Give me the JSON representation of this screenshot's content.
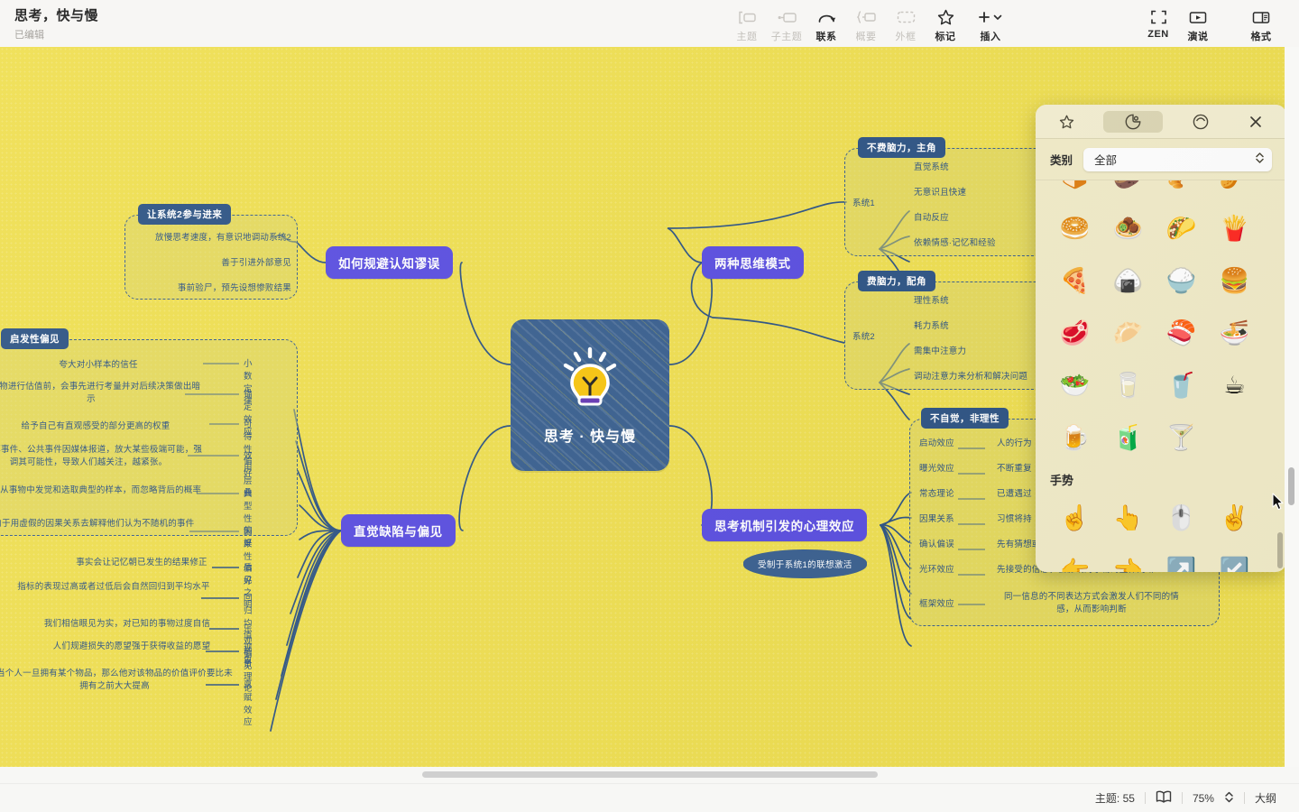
{
  "document": {
    "title": "思考，快与慢",
    "status": "已编辑"
  },
  "toolbar": {
    "center": [
      {
        "label": "主题",
        "icon": "topic-icon",
        "state": "disabled"
      },
      {
        "label": "子主题",
        "icon": "subtopic-icon",
        "state": "disabled"
      },
      {
        "label": "联系",
        "icon": "relation-icon",
        "state": "enabled"
      },
      {
        "label": "概要",
        "icon": "summary-icon",
        "state": "disabled"
      },
      {
        "label": "外框",
        "icon": "boundary-icon",
        "state": "disabled"
      },
      {
        "label": "标记",
        "icon": "marker-star-icon",
        "state": "enabled"
      },
      {
        "label": "插入",
        "icon": "plus-icon",
        "state": "enabled"
      }
    ],
    "right": [
      {
        "label": "ZEN",
        "icon": "zen-icon"
      },
      {
        "label": "演说",
        "icon": "presentation-icon"
      },
      {
        "label": "格式",
        "icon": "format-panel-icon"
      }
    ]
  },
  "sticker_panel": {
    "tabs": [
      {
        "name": "favorites",
        "icon": "star-icon",
        "selected": false
      },
      {
        "name": "stickers",
        "icon": "sticker-icon",
        "selected": true
      },
      {
        "name": "emoji",
        "icon": "emoji-icon",
        "selected": false
      }
    ],
    "close_icon": "close-icon",
    "category_label": "类别",
    "category_value": "全部",
    "category_options": [
      "全部"
    ],
    "rows": [
      {
        "type": "emoji",
        "items": [
          "🍞",
          "🥔",
          "🥐",
          "🥜"
        ]
      },
      {
        "type": "emoji",
        "items": [
          "🥯",
          "🧆",
          "🌮",
          "🍟"
        ]
      },
      {
        "type": "emoji",
        "items": [
          "🍕",
          "🍙",
          "🍚",
          "🍔"
        ]
      },
      {
        "type": "emoji",
        "items": [
          "🥩",
          "🥟",
          "🍣",
          "🍜"
        ]
      },
      {
        "type": "emoji",
        "items": [
          "🥗",
          "🥛",
          "🥤",
          "☕"
        ]
      },
      {
        "type": "emoji",
        "items": [
          "🍺",
          "🧃",
          "🍸",
          ""
        ]
      }
    ],
    "section_title": "手势",
    "gesture_rows": [
      {
        "items": [
          "☝️",
          "👆",
          "🖱️",
          "✌️"
        ]
      },
      {
        "items": [
          "👉",
          "👈",
          "↗️",
          "↙️"
        ]
      }
    ]
  },
  "mindmap": {
    "central": {
      "label": "思考 · 快与慢",
      "icon": "lightbulb-icon"
    },
    "branches": [
      {
        "id": "avoid",
        "label": "如何规避认知谬误"
      },
      {
        "id": "twomodes",
        "label": "两种思维模式"
      },
      {
        "id": "defects",
        "label": "直觉缺陷与偏见"
      },
      {
        "id": "effects",
        "label": "思考机制引发的心理效应"
      }
    ],
    "callout": "受制于系统1的联想激活",
    "groups": {
      "system2_join": {
        "tag": "让系统2参与进来",
        "items": [
          "放慢思考速度，有意识地调动系统2",
          "善于引进外部意见",
          "事前验尸，预先设想惨败结果"
        ]
      },
      "system1": {
        "tag": "不费脑力，主角",
        "root": "系统1",
        "items": [
          "直觉系统",
          "无意识且快速",
          "自动反应",
          "依赖情感·记忆和经验"
        ]
      },
      "system2": {
        "tag": "费脑力，配角",
        "root": "系统2",
        "items": [
          "理性系统",
          "耗力系统",
          "需集中注意力",
          "调动注意力来分析和解决问题"
        ]
      },
      "heuristic_bias": {
        "tag": "启发性偏见",
        "pairs": [
          {
            "desc": "夸大对小样本的信任",
            "name": "小数定律"
          },
          {
            "desc": "对事物进行估值前，会事先进行考量并对后续决策做出暗示",
            "name": "锚定效应"
          },
          {
            "desc": "给予自己有直观感受的部分更高的权重",
            "name": "可得性偏好"
          },
          {
            "desc": "小概率事件、公共事件因媒体报道，放大某些极端可能，强调其可能性，导致人们越关注，越紧张。",
            "name": "效用层叠"
          },
          {
            "desc": "习惯从事物中发觉和选取典型的样本，而忽略背后的概率",
            "name": "典型性偏好"
          },
          {
            "desc": "倾向于用虚假的因果关系去解释他们认为不随机的事件",
            "name": "因果性偏好"
          },
          {
            "desc": "事实会让记忆朝已发生的结果修正",
            "name": "后见之明"
          },
          {
            "desc": "指标的表现过高或者过低后会自然回归到平均水平",
            "name": "回归均值现象"
          },
          {
            "desc": "我们相信眼见为实，对已知的事物过度自信",
            "name": "乐观偏见"
          },
          {
            "desc": "人们规避损失的愿望强于获得收益的愿望",
            "name": "前景理论"
          },
          {
            "desc": "当个人一旦拥有某个物品，那么他对该物品的价值评价要比未拥有之前大大提高",
            "name": "禀赋效应"
          }
        ]
      },
      "irrational": {
        "tag": "不自觉，非理性",
        "pairs": [
          {
            "name": "启动效应",
            "desc": "人的行为"
          },
          {
            "name": "曝光效应",
            "desc": "不断重复"
          },
          {
            "name": "常态理论",
            "desc": "已遭遇过"
          },
          {
            "name": "因果关系",
            "desc": "习惯将持"
          },
          {
            "name": "确认偏误",
            "desc": "先有猜想或观点并寻找证据支持自己的偏好或猜想"
          },
          {
            "name": "光环效应",
            "desc": "先接受的信息，会影响对事物的整体判断"
          },
          {
            "name": "框架效应",
            "desc": "同一信息的不同表达方式会激发人们不同的情感，从而影响判断"
          }
        ]
      }
    }
  },
  "statusbar": {
    "topic_count": "主题: 55",
    "map_icon": "map-view-icon",
    "zoom": "75%",
    "stepper_icon": "stepper-icon",
    "outline": "大纲"
  },
  "colors": {
    "canvas": "#efdf52",
    "node_purple": "#5b4fe0",
    "node_blue": "#3b6190",
    "group_fill": "#dad56e",
    "panel": "#f2ecc9"
  }
}
